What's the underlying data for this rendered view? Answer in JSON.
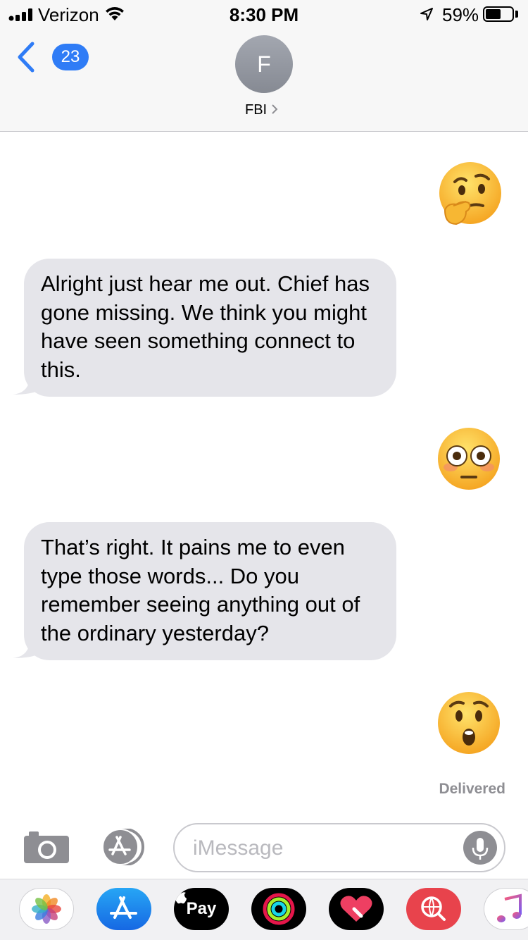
{
  "status_bar": {
    "carrier": "Verizon",
    "time": "8:30 PM",
    "battery_percent": "59%",
    "battery_level": 0.59
  },
  "header": {
    "back_badge": "23",
    "avatar_initial": "F",
    "contact_name": "FBI"
  },
  "messages": [
    {
      "direction": "outgoing",
      "emoji": "thinking-face"
    },
    {
      "direction": "incoming",
      "text": "Alright just hear me out. Chief has gone missing. We think you might have seen something connect to this."
    },
    {
      "direction": "outgoing",
      "emoji": "flushed-face"
    },
    {
      "direction": "incoming",
      "text": "That’s right. It pains me to even type those words... Do you remember seeing anything out of the ordinary yesterday?"
    },
    {
      "direction": "outgoing",
      "emoji": "hushed-face"
    }
  ],
  "delivered_label": "Delivered",
  "input": {
    "placeholder": "iMessage"
  },
  "app_drawer": {
    "apps": [
      "photos",
      "app-store",
      "apple-pay",
      "activity",
      "digital-touch",
      "images-search",
      "music"
    ],
    "apple_pay_label": "Pay"
  },
  "colors": {
    "accent": "#2f7cf6",
    "incoming_bubble": "#e5e5ea",
    "header_bg": "#f7f7f7"
  }
}
